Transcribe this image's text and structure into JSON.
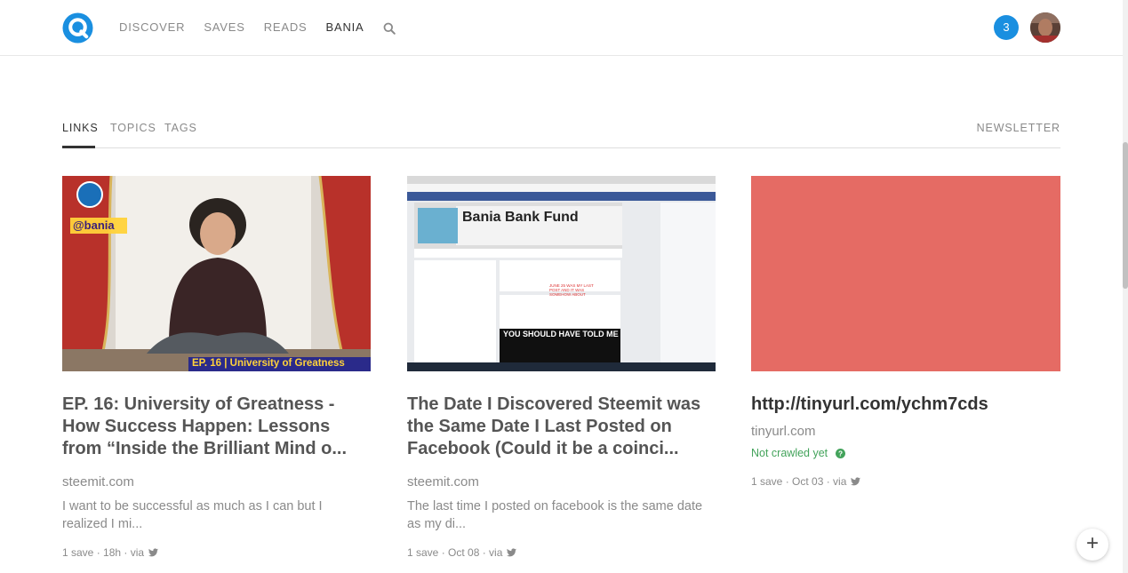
{
  "nav": {
    "items": [
      "DISCOVER",
      "SAVES",
      "READS",
      "BANIA"
    ],
    "notification_count": "3"
  },
  "subtabs": {
    "items": [
      "LINKS",
      "TOPICS",
      "TAGS"
    ],
    "newsletter": "NEWSLETTER"
  },
  "cards": [
    {
      "thumb_text": {
        "handle": "@bania",
        "episode": "EP. 16 | University of Greatness"
      },
      "title": "EP. 16: University of Greatness - How Success Happen: Lessons from “Inside the Brilliant Mind o...",
      "domain": "steemit.com",
      "excerpt": "I want to be successful as much as I can but I realized I mi...",
      "meta": "1 save · 18h · via"
    },
    {
      "thumb_text": {
        "page_title": "Bania Bank Fund",
        "post_note": "JUNE 25 WAS MY LAST POST AND IT WAS SOMEHOW ABOUT BITCOIN",
        "meme": "YOU SHOULD HAVE TOLD ME"
      },
      "title": "The Date I Discovered Steemit was the Same Date I Last Posted on Facebook (Could it be a coinci...",
      "domain": "steemit.com",
      "excerpt": "The last time I posted on facebook is the same date as my di...",
      "meta": "1 save · Oct 08 · via"
    },
    {
      "title": "http://tinyurl.com/ychm7cds",
      "domain": "tinyurl.com",
      "status": "Not crawled yet",
      "meta": "1 save · Oct 03 · via",
      "placeholder_color": "#e56b64"
    }
  ],
  "fab": {
    "label": "+"
  },
  "colors": {
    "accent": "#1a8fe0",
    "success": "#43a35b"
  }
}
